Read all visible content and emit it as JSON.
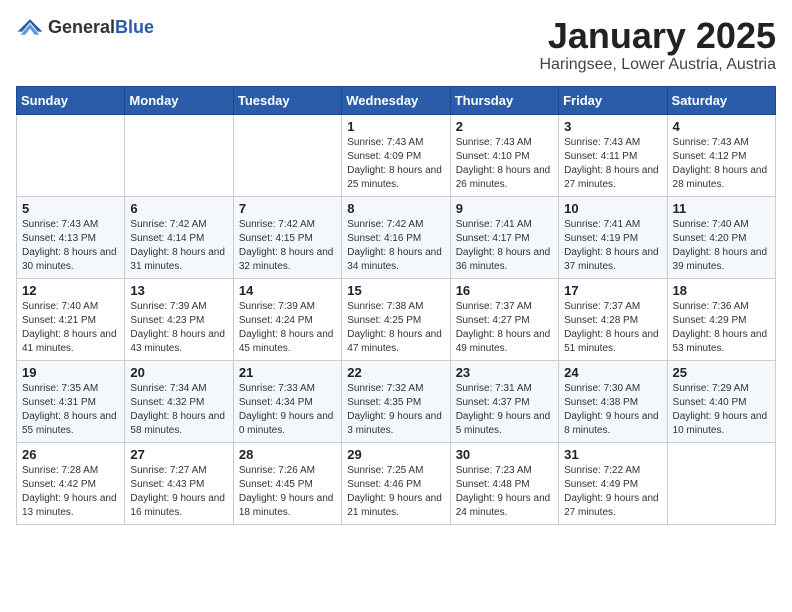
{
  "header": {
    "logo_general": "General",
    "logo_blue": "Blue",
    "month_title": "January 2025",
    "location": "Haringsee, Lower Austria, Austria"
  },
  "weekdays": [
    "Sunday",
    "Monday",
    "Tuesday",
    "Wednesday",
    "Thursday",
    "Friday",
    "Saturday"
  ],
  "weeks": [
    [
      {
        "day": "",
        "info": ""
      },
      {
        "day": "",
        "info": ""
      },
      {
        "day": "",
        "info": ""
      },
      {
        "day": "1",
        "info": "Sunrise: 7:43 AM\nSunset: 4:09 PM\nDaylight: 8 hours and 25 minutes."
      },
      {
        "day": "2",
        "info": "Sunrise: 7:43 AM\nSunset: 4:10 PM\nDaylight: 8 hours and 26 minutes."
      },
      {
        "day": "3",
        "info": "Sunrise: 7:43 AM\nSunset: 4:11 PM\nDaylight: 8 hours and 27 minutes."
      },
      {
        "day": "4",
        "info": "Sunrise: 7:43 AM\nSunset: 4:12 PM\nDaylight: 8 hours and 28 minutes."
      }
    ],
    [
      {
        "day": "5",
        "info": "Sunrise: 7:43 AM\nSunset: 4:13 PM\nDaylight: 8 hours and 30 minutes."
      },
      {
        "day": "6",
        "info": "Sunrise: 7:42 AM\nSunset: 4:14 PM\nDaylight: 8 hours and 31 minutes."
      },
      {
        "day": "7",
        "info": "Sunrise: 7:42 AM\nSunset: 4:15 PM\nDaylight: 8 hours and 32 minutes."
      },
      {
        "day": "8",
        "info": "Sunrise: 7:42 AM\nSunset: 4:16 PM\nDaylight: 8 hours and 34 minutes."
      },
      {
        "day": "9",
        "info": "Sunrise: 7:41 AM\nSunset: 4:17 PM\nDaylight: 8 hours and 36 minutes."
      },
      {
        "day": "10",
        "info": "Sunrise: 7:41 AM\nSunset: 4:19 PM\nDaylight: 8 hours and 37 minutes."
      },
      {
        "day": "11",
        "info": "Sunrise: 7:40 AM\nSunset: 4:20 PM\nDaylight: 8 hours and 39 minutes."
      }
    ],
    [
      {
        "day": "12",
        "info": "Sunrise: 7:40 AM\nSunset: 4:21 PM\nDaylight: 8 hours and 41 minutes."
      },
      {
        "day": "13",
        "info": "Sunrise: 7:39 AM\nSunset: 4:23 PM\nDaylight: 8 hours and 43 minutes."
      },
      {
        "day": "14",
        "info": "Sunrise: 7:39 AM\nSunset: 4:24 PM\nDaylight: 8 hours and 45 minutes."
      },
      {
        "day": "15",
        "info": "Sunrise: 7:38 AM\nSunset: 4:25 PM\nDaylight: 8 hours and 47 minutes."
      },
      {
        "day": "16",
        "info": "Sunrise: 7:37 AM\nSunset: 4:27 PM\nDaylight: 8 hours and 49 minutes."
      },
      {
        "day": "17",
        "info": "Sunrise: 7:37 AM\nSunset: 4:28 PM\nDaylight: 8 hours and 51 minutes."
      },
      {
        "day": "18",
        "info": "Sunrise: 7:36 AM\nSunset: 4:29 PM\nDaylight: 8 hours and 53 minutes."
      }
    ],
    [
      {
        "day": "19",
        "info": "Sunrise: 7:35 AM\nSunset: 4:31 PM\nDaylight: 8 hours and 55 minutes."
      },
      {
        "day": "20",
        "info": "Sunrise: 7:34 AM\nSunset: 4:32 PM\nDaylight: 8 hours and 58 minutes."
      },
      {
        "day": "21",
        "info": "Sunrise: 7:33 AM\nSunset: 4:34 PM\nDaylight: 9 hours and 0 minutes."
      },
      {
        "day": "22",
        "info": "Sunrise: 7:32 AM\nSunset: 4:35 PM\nDaylight: 9 hours and 3 minutes."
      },
      {
        "day": "23",
        "info": "Sunrise: 7:31 AM\nSunset: 4:37 PM\nDaylight: 9 hours and 5 minutes."
      },
      {
        "day": "24",
        "info": "Sunrise: 7:30 AM\nSunset: 4:38 PM\nDaylight: 9 hours and 8 minutes."
      },
      {
        "day": "25",
        "info": "Sunrise: 7:29 AM\nSunset: 4:40 PM\nDaylight: 9 hours and 10 minutes."
      }
    ],
    [
      {
        "day": "26",
        "info": "Sunrise: 7:28 AM\nSunset: 4:42 PM\nDaylight: 9 hours and 13 minutes."
      },
      {
        "day": "27",
        "info": "Sunrise: 7:27 AM\nSunset: 4:43 PM\nDaylight: 9 hours and 16 minutes."
      },
      {
        "day": "28",
        "info": "Sunrise: 7:26 AM\nSunset: 4:45 PM\nDaylight: 9 hours and 18 minutes."
      },
      {
        "day": "29",
        "info": "Sunrise: 7:25 AM\nSunset: 4:46 PM\nDaylight: 9 hours and 21 minutes."
      },
      {
        "day": "30",
        "info": "Sunrise: 7:23 AM\nSunset: 4:48 PM\nDaylight: 9 hours and 24 minutes."
      },
      {
        "day": "31",
        "info": "Sunrise: 7:22 AM\nSunset: 4:49 PM\nDaylight: 9 hours and 27 minutes."
      },
      {
        "day": "",
        "info": ""
      }
    ]
  ]
}
